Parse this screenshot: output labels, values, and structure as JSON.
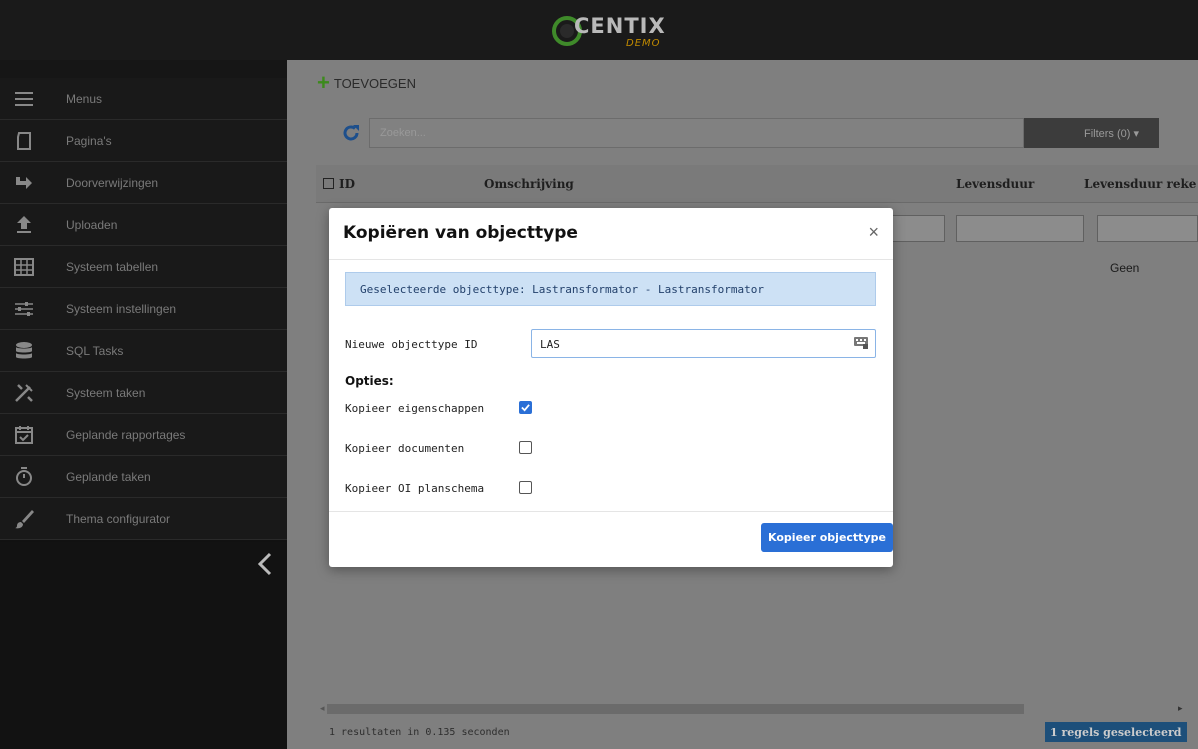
{
  "app": {
    "logo_text": "CENTIX",
    "logo_sub": "DEMO"
  },
  "sidebar": {
    "items": [
      {
        "label": "Menus",
        "icon": "hamburger-icon"
      },
      {
        "label": "Pagina's",
        "icon": "page-icon"
      },
      {
        "label": "Doorverwijzingen",
        "icon": "redirect-arrow-icon"
      },
      {
        "label": "Uploaden",
        "icon": "upload-icon"
      },
      {
        "label": "Systeem tabellen",
        "icon": "table-icon"
      },
      {
        "label": "Systeem instellingen",
        "icon": "sliders-icon"
      },
      {
        "label": "SQL Tasks",
        "icon": "database-icon"
      },
      {
        "label": "Systeem taken",
        "icon": "tools-icon"
      },
      {
        "label": "Geplande rapportages",
        "icon": "calendar-check-icon"
      },
      {
        "label": "Geplande taken",
        "icon": "stopwatch-icon"
      },
      {
        "label": "Thema configurator",
        "icon": "brush-icon"
      }
    ],
    "collapse_icon": "chevron-left-icon"
  },
  "toolbar": {
    "add_label": "TOEVOEGEN",
    "search_placeholder": "Zoeken...",
    "filters_label": "Filters (0) ▾"
  },
  "table": {
    "columns": [
      "ID",
      "Omschrijving",
      "Levensduur",
      "Levensduur reke"
    ],
    "row_value": "Geen",
    "result_text": "1 resultaten in 0.135 seconden",
    "selected_text": "1 regels geselecteerd"
  },
  "modal": {
    "title": "Kopiëren van objecttype",
    "close": "×",
    "alert": "Geselecteerde objecttype: Lastransformator - Lastransformator",
    "new_id_label": "Nieuwe objecttype ID",
    "new_id_value": "LAS",
    "options_label": "Opties:",
    "options": [
      {
        "label": "Kopieer eigenschappen",
        "checked": true
      },
      {
        "label": "Kopieer documenten",
        "checked": false
      },
      {
        "label": "Kopieer OI planschema",
        "checked": false
      }
    ],
    "submit_label": "Kopieer objecttype"
  },
  "colors": {
    "accent": "#2a6fd6",
    "add_green": "#3c8a1c",
    "alert_bg": "#cde1f5"
  }
}
